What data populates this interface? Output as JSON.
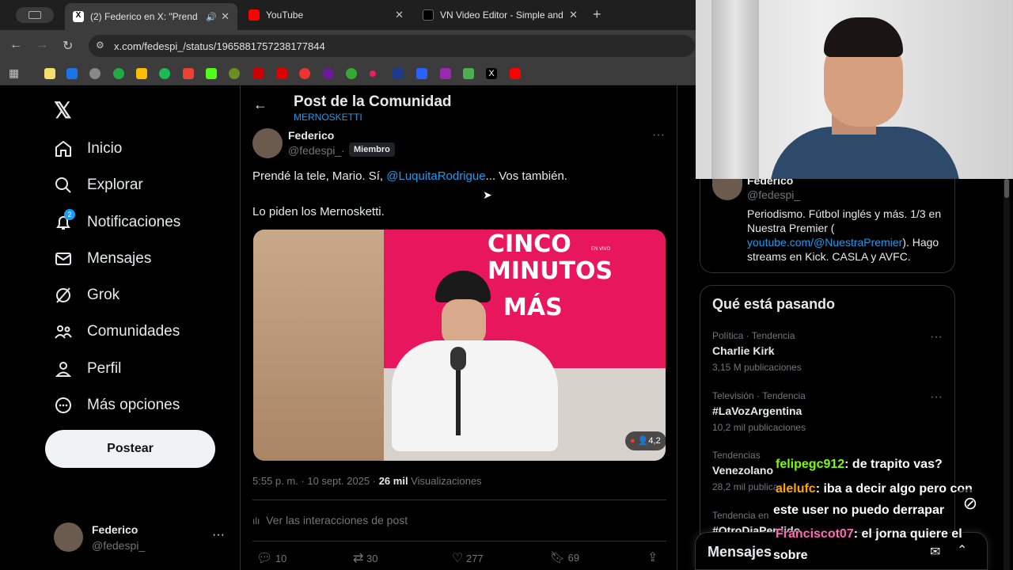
{
  "browser": {
    "tabs": [
      {
        "title": "(2) Federico en X: \"Prend",
        "active": true
      },
      {
        "title": "YouTube",
        "active": false
      },
      {
        "title": "VN Video Editor - Simple and",
        "active": false
      }
    ],
    "url": "x.com/fedespi_/status/1965881757238177844"
  },
  "nav": {
    "items": [
      {
        "label": "Inicio",
        "icon": "home-icon"
      },
      {
        "label": "Explorar",
        "icon": "search-icon"
      },
      {
        "label": "Notificaciones",
        "icon": "bell-icon",
        "badge": "2"
      },
      {
        "label": "Mensajes",
        "icon": "mail-icon"
      },
      {
        "label": "Grok",
        "icon": "grok-icon"
      },
      {
        "label": "Comunidades",
        "icon": "people-icon"
      },
      {
        "label": "Perfil",
        "icon": "person-icon"
      },
      {
        "label": "Más opciones",
        "icon": "more-circle-icon"
      }
    ],
    "post_button": "Postear",
    "account": {
      "name": "Federico",
      "handle": "@fedespi_"
    }
  },
  "header": {
    "title": "Post de la Comunidad",
    "community": "MERNOSKETTI"
  },
  "post": {
    "author": "Federico",
    "handle": "@fedespi_",
    "sep": "·",
    "role_badge": "Miembro",
    "text_pre": "Prendé la tele, Mario. Sí, ",
    "mention": "@LuquitaRodrigue",
    "text_post": "... Vos también.",
    "text_line2": "Lo piden los Mernosketti.",
    "media": {
      "sign_line1": "CINCO",
      "sign_line2": "MINUTOS",
      "sign_line3": "MÁS",
      "live_label": "EN VIVO",
      "viewer_count": "4,2"
    },
    "timestamp": "5:55 p. m. · 10 sept. 2025 · ",
    "views_count": "26 mil",
    "views_label": " Visualizaciones",
    "interactions_label": "Ver las interacciones de post",
    "replies": "10",
    "reposts": "30",
    "likes": "277",
    "bookmarks": "69"
  },
  "profile_card": {
    "name": "Federico",
    "handle": "@fedespi_",
    "bio_line1": "Periodismo. Fútbol inglés y más. 1/3 en",
    "bio_line2": "Nuestra Premier (",
    "bio_link": "youtube.com/@NuestraPremier",
    "bio_line3_post": "). Hago",
    "bio_line4": "streams en Kick. CASLA y AVFC."
  },
  "trends": {
    "title": "Qué está pasando",
    "items": [
      {
        "meta": "Política · Tendencia",
        "name": "Charlie Kirk",
        "count": "3,15 M publicaciones"
      },
      {
        "meta": "Televisión · Tendencia",
        "name": "#LaVozArgentina",
        "count": "10,2 mil publicaciones"
      },
      {
        "meta": "Tendencias",
        "name": "Venezolano",
        "count": "28,2 mil publicac"
      },
      {
        "meta": "Tendencia en",
        "name": "#OtroDiaPerdido",
        "count": ""
      }
    ]
  },
  "messages_drawer": {
    "label": "Mensajes"
  },
  "stream_chat": [
    {
      "user": "felipegc912",
      "color": "#7cfc00",
      "text": ": de trapito vas?"
    },
    {
      "user": "alelufc",
      "color": "#ffa500",
      "text": ": iba a decir algo pero con"
    },
    {
      "user": "",
      "color": "#ffffff",
      "text": "este user no puedo derrapar"
    },
    {
      "user": "Franciscot07",
      "color": "#ff69b4",
      "text": ": el jorna quiere el"
    },
    {
      "user": "",
      "color": "#ffffff",
      "text": "sobre"
    }
  ],
  "colors": {
    "accent": "#1d9bf0",
    "bg": "#000000",
    "border": "#2f3336"
  }
}
